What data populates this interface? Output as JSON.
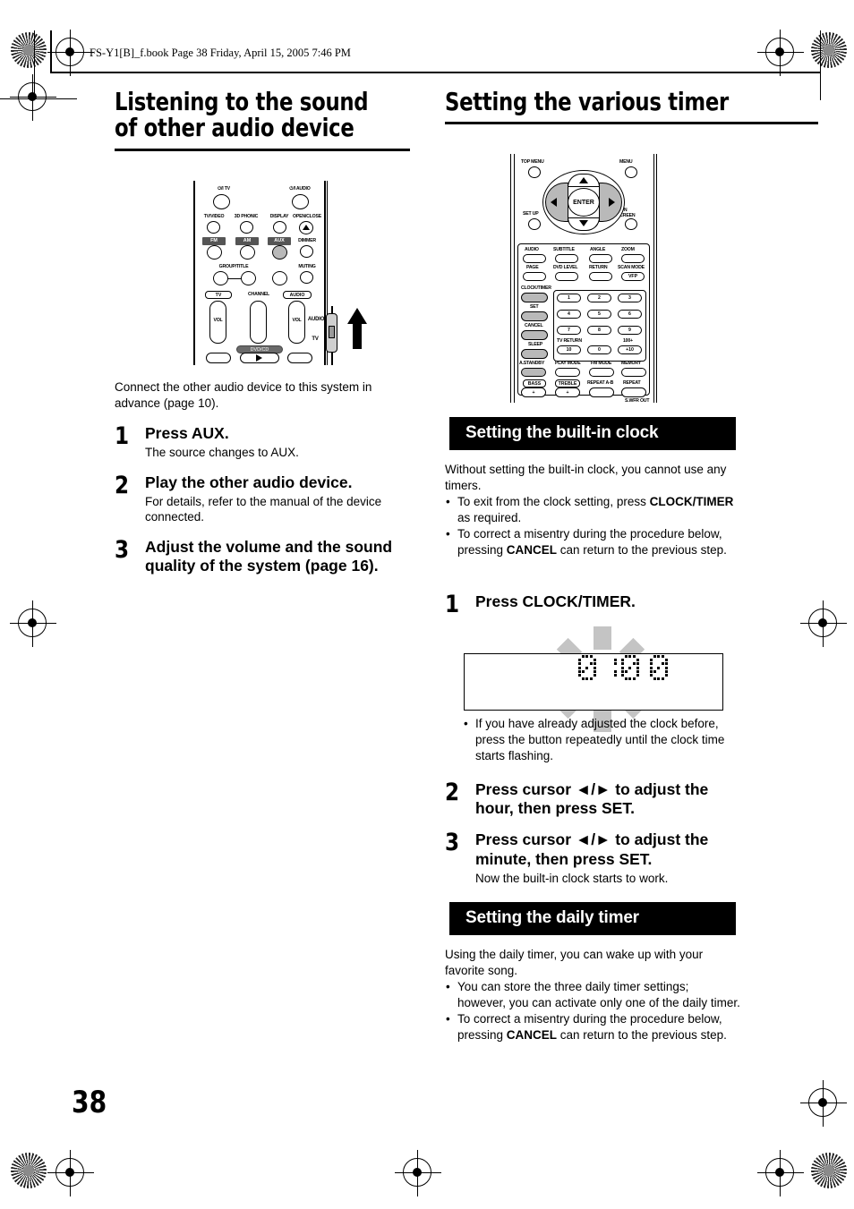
{
  "header": {
    "file_line": "FS-Y1[B]_f.book  Page 38  Friday, April 15, 2005  7:46 PM"
  },
  "page_number": "38",
  "left_column": {
    "heading": "Listening to the sound of other audio device",
    "intro": "Connect the other audio device to this system in advance (page 10).",
    "steps": [
      {
        "num": "1",
        "title": "Press AUX.",
        "sub": "The source changes to AUX."
      },
      {
        "num": "2",
        "title": "Play the other audio device.",
        "sub": "For details, refer to the manual of the device connected."
      },
      {
        "num": "3",
        "title": "Adjust the volume and the sound quality of the system (page 16).",
        "sub": ""
      }
    ],
    "remote_labels": {
      "power_tv": "TV",
      "power_audio": "AUDIO",
      "tv_video": "TV/VIDEO",
      "sd_phonic": "3D PHONIC",
      "display": "DISPLAY",
      "open_close": "OPEN/CLOSE",
      "fm": "FM",
      "am": "AM",
      "aux": "AUX",
      "dimmer": "DIMMER",
      "group_title": "GROUP/TITLE",
      "muting": "MUTING",
      "tv": "TV",
      "channel": "CHANNEL",
      "audio": "AUDIO",
      "vol": "VOL",
      "dvd_cd": "DVD/CD",
      "switch_audio": "AUDIO",
      "switch_tv": "TV"
    }
  },
  "right_column": {
    "heading": "Setting the various timer",
    "remote_labels": {
      "top_menu": "TOP MENU",
      "menu": "MENU",
      "set_up": "SET UP",
      "on_screen": "ON SCREEN",
      "enter": "ENTER",
      "row1": [
        "AUDIO",
        "SUBTITLE",
        "ANGLE",
        "ZOOM"
      ],
      "row2": [
        "PAGE",
        "DVD LEVEL",
        "RETURN",
        "SCAN MODE"
      ],
      "vfp": "VFP",
      "clock_timer": "CLOCK/TIMER",
      "set": "SET",
      "cancel": "CANCEL",
      "sleep": "SLEEP",
      "a_standby": "A.STANDBY",
      "play_mode": "PLAY MODE",
      "fm_mode": "FM MODE",
      "memory": "MEMORY",
      "bass": "BASS",
      "treble": "TREBLE",
      "repeat_ab": "REPEAT A-B",
      "repeat": "REPEAT",
      "swfr_out": "S.WFR OUT",
      "tv_return": "TV RETURN",
      "hundred_plus": "100+",
      "keys": [
        "1",
        "2",
        "3",
        "4",
        "5",
        "6",
        "7",
        "8",
        "9",
        "10",
        "0",
        "+10"
      ]
    },
    "section_clock": {
      "bar_title": "Setting the built-in clock",
      "intro": "Without setting the built-in clock, you cannot use any timers.",
      "bullets": [
        {
          "pre": "To exit from the clock setting, press ",
          "bold": "CLOCK/TIMER",
          "post": " as required."
        },
        {
          "pre": "To correct a misentry during the procedure below, pressing ",
          "bold": "CANCEL",
          "post": " can return to the previous step."
        }
      ],
      "steps": [
        {
          "num": "1",
          "title": "Press CLOCK/TIMER.",
          "sub": ""
        },
        {
          "num": "2",
          "title": "Press cursor ◄/► to adjust the hour, then press SET.",
          "sub": ""
        },
        {
          "num": "3",
          "title": "Press cursor ◄/► to adjust the minute, then press SET.",
          "sub": "Now the built-in clock starts to work."
        }
      ],
      "display_value": "0:00",
      "note_bullet": "If you have already adjusted the clock before, press the button repeatedly until the clock time starts flashing."
    },
    "section_daily": {
      "bar_title": "Setting the daily timer",
      "intro": "Using the daily timer, you can wake up with your favorite song.",
      "bullets": [
        {
          "pre": "You can store the three daily timer settings; however, you can activate only one of the daily timer.",
          "bold": "",
          "post": ""
        },
        {
          "pre": "To correct a misentry during the procedure below, pressing ",
          "bold": "CANCEL",
          "post": " can return to the previous step."
        }
      ]
    }
  }
}
